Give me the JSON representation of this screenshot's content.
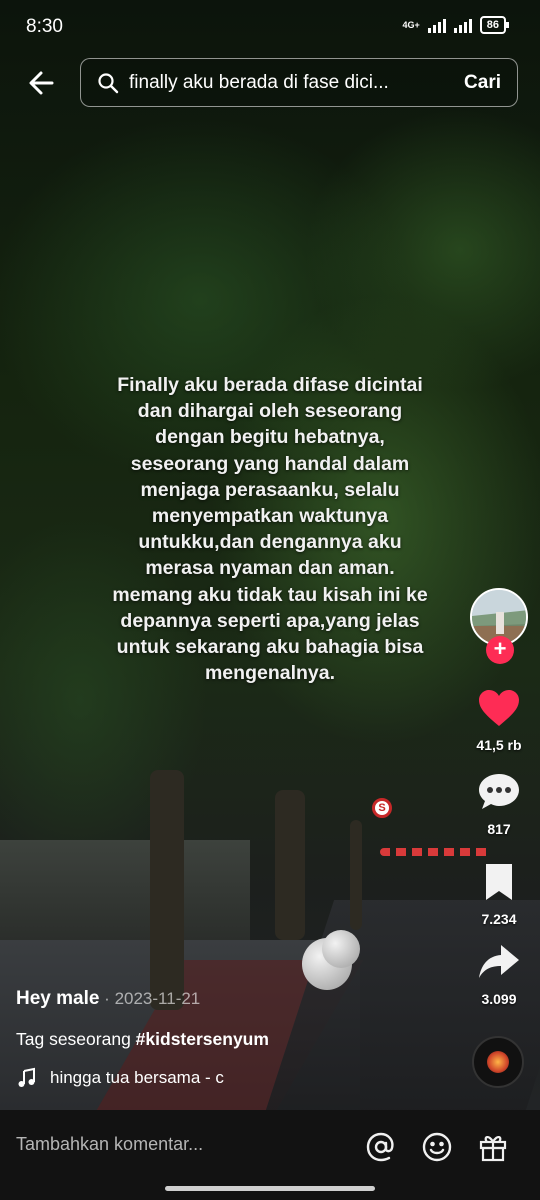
{
  "status_bar": {
    "time": "8:30",
    "network": "4G+",
    "battery": "86"
  },
  "search": {
    "query": "finally aku berada di fase dici...",
    "submit_label": "Cari"
  },
  "video": {
    "caption": "Finally aku berada difase dicintai dan dihargai oleh seseorang dengan begitu hebatnya, seseorang yang handal dalam menjaga perasaanku, selalu menyempatkan waktunya untukku,dan dengannya aku merasa nyaman dan aman. memang aku tidak tau kisah ini ke depannya seperti apa,yang jelas untuk sekarang aku bahagia bisa mengenalnya.",
    "sign_letter": "S"
  },
  "rail": {
    "likes": "41,5 rb",
    "comments": "817",
    "saves": "7.234",
    "shares": "3.099",
    "follow_symbol": "+"
  },
  "post": {
    "author": "Hey male",
    "separator": " · ",
    "date": "2023-11-21",
    "desc_prefix": "Tag seseorang ",
    "hashtag": "#kidstersenyum",
    "music_title": "hingga tua bersama - c"
  },
  "comment_bar": {
    "placeholder": "Tambahkan komentar..."
  },
  "colors": {
    "like": "#fe2c55",
    "accent": "#fe2c55",
    "comment_bar_bg": "#121212"
  }
}
